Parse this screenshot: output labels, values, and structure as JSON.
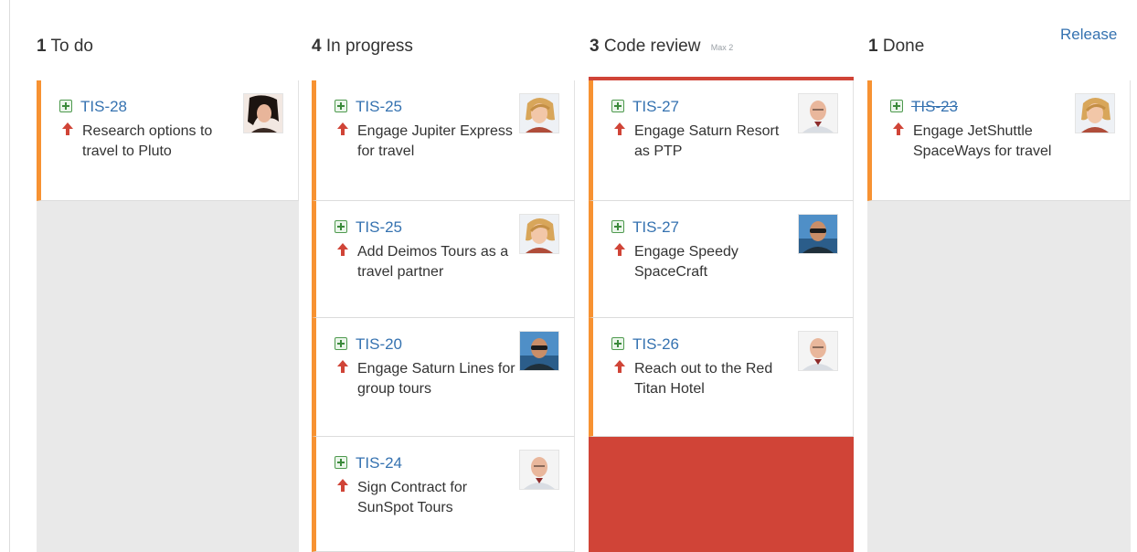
{
  "board": {
    "release_label": "Release",
    "columns": [
      {
        "count": "1",
        "name": "To do",
        "max_note": ""
      },
      {
        "count": "4",
        "name": "In progress",
        "max_note": ""
      },
      {
        "count": "3",
        "name": "Code review",
        "max_note": "Max 2"
      },
      {
        "count": "1",
        "name": "Done",
        "max_note": ""
      }
    ]
  },
  "cards": {
    "todo": [
      {
        "key": "TIS-28",
        "summary": "Research options to travel to Pluto",
        "issue_type_icon": "story-add-icon",
        "priority_icon": "priority-arrow-up-icon",
        "avatar": "avatar-woman-dark-hair"
      }
    ],
    "in_progress": [
      {
        "key": "TIS-25",
        "summary": "Engage Jupiter Express for travel",
        "issue_type_icon": "story-add-icon",
        "priority_icon": "priority-arrow-up-icon",
        "avatar": "avatar-woman-blonde"
      },
      {
        "key": "TIS-25",
        "summary": "Add Deimos Tours as a travel partner",
        "issue_type_icon": "story-add-icon",
        "priority_icon": "priority-arrow-up-icon",
        "avatar": "avatar-woman-blonde"
      },
      {
        "key": "TIS-20",
        "summary": "Engage Saturn Lines for group tours",
        "issue_type_icon": "story-add-icon",
        "priority_icon": "priority-arrow-up-icon",
        "avatar": "avatar-man-sunglasses"
      },
      {
        "key": "TIS-24",
        "summary": "Sign Contract for SunSpot Tours",
        "issue_type_icon": "story-add-icon",
        "priority_icon": "priority-arrow-up-icon",
        "avatar": "avatar-man-bald"
      }
    ],
    "code_review": [
      {
        "key": "TIS-27",
        "summary": "Engage Saturn Resort as PTP",
        "issue_type_icon": "story-add-icon",
        "priority_icon": "priority-arrow-up-icon",
        "avatar": "avatar-man-bald"
      },
      {
        "key": "TIS-27",
        "summary": "Engage Speedy SpaceCraft",
        "issue_type_icon": "story-add-icon",
        "priority_icon": "priority-arrow-up-icon",
        "avatar": "avatar-man-sunglasses"
      },
      {
        "key": "TIS-26",
        "summary": "Reach out to the Red Titan Hotel",
        "issue_type_icon": "story-add-icon",
        "priority_icon": "priority-arrow-up-icon",
        "avatar": "avatar-man-bald"
      }
    ],
    "done": [
      {
        "key": "TIS-23",
        "summary": "Engage JetShuttle SpaceWays for travel",
        "issue_type_icon": "story-add-icon",
        "priority_icon": "priority-arrow-up-icon",
        "avatar": "avatar-woman-blonde"
      }
    ]
  },
  "colors": {
    "link": "#3572b0",
    "card_flag": "#f79232",
    "over_limit": "#d04437",
    "column_bg": "#e9e9e9",
    "priority": "#d04437",
    "story_icon": "#4e9a4e"
  }
}
